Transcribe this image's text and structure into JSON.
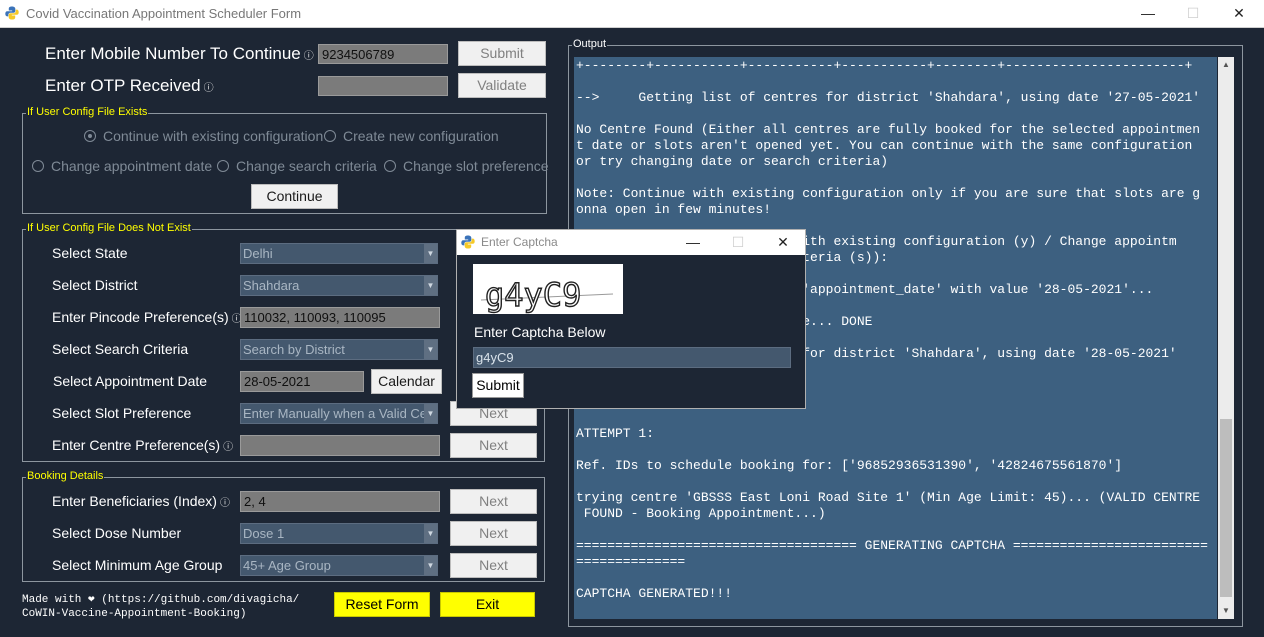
{
  "window": {
    "title": "Covid Vaccination Appointment Scheduler Form",
    "minimize": "—",
    "maximize": "☐",
    "close": "✕"
  },
  "mobile": {
    "label": "Enter Mobile Number To Continue",
    "info": "ⓘ",
    "value": "9234506789",
    "submit": "Submit"
  },
  "otp": {
    "label": "Enter OTP Received",
    "info": "ⓘ",
    "value": "",
    "validate": "Validate"
  },
  "config_exists": {
    "legend": "If User Config File Exists",
    "options": [
      "Continue with existing configuration",
      "Create new configuration",
      "Change appointment date",
      "Change search criteria",
      "Change slot preference"
    ],
    "selected_index": 0,
    "continue": "Continue"
  },
  "config_new": {
    "legend": "If User Config File Does Not Exist",
    "state": {
      "label": "Select State",
      "value": "Delhi"
    },
    "district": {
      "label": "Select District",
      "value": "Shahdara"
    },
    "pincode": {
      "label": "Enter Pincode Preference(s)",
      "info": "ⓘ",
      "value": "110032, 110093, 110095"
    },
    "search": {
      "label": "Select Search Criteria",
      "value": "Search by District"
    },
    "date": {
      "label": "Select Appointment Date",
      "value": "28-05-2021",
      "calendar": "Calendar"
    },
    "slot": {
      "label": "Select Slot Preference",
      "value": "Enter Manually when a Valid Ce",
      "next": "Next"
    },
    "centre": {
      "label": "Enter Centre Preference(s)",
      "info": "ⓘ",
      "value": "",
      "next": "Next"
    }
  },
  "booking": {
    "legend": "Booking Details",
    "beneficiaries": {
      "label": "Enter Beneficiaries (Index)",
      "info": "ⓘ",
      "value": "2, 4",
      "next": "Next"
    },
    "dose": {
      "label": "Select Dose Number",
      "value": "Dose 1",
      "next": "Next"
    },
    "age": {
      "label": "Select Minimum Age Group",
      "value": "45+ Age Group",
      "next": "Next"
    }
  },
  "footer": {
    "made_with_line1": "Made with ❤ (https://github.com/divagicha/",
    "made_with_line2": "CoWIN-Vaccine-Appointment-Booking)",
    "reset": "Reset Form",
    "exit": "Exit"
  },
  "output": {
    "legend": "Output",
    "lines": [
      "+--------+-----------+-----------+-----------+--------+-----------------------+",
      "",
      "-->     Getting list of centres for district 'Shahdara', using date '27-05-2021'",
      "",
      "No Centre Found (Either all centres are fully booked for the selected appointmen",
      "t date or slots aren't opened yet. You can continue with the same configuration",
      "or try changing date or search criteria)",
      "",
      "Note: Continue with existing configuration only if you are sure that slots are g",
      "onna open in few minutes!",
      "",
      "                          e with existing configuration (y) / Change appointm",
      "                          criteria (s)):",
      "",
      "                          le 'appointment_date' with value '28-05-2021'...",
      "",
      "                          file... DONE",
      "",
      "                          es for district 'Shahdara', using date '28-05-2021'",
      "",
      "",
      "",
      "",
      "ATTEMPT 1:",
      "",
      "Ref. IDs to schedule booking for: ['96852936531390', '42824675561870']",
      "",
      "trying centre 'GBSSS East Loni Road Site 1' (Min Age Limit: 45)... (VALID CENTRE",
      " FOUND - Booking Appointment...)",
      "",
      "==================================== GENERATING CAPTCHA =========================",
      "==============",
      "",
      "CAPTCHA GENERATED!!!"
    ]
  },
  "captcha_dialog": {
    "title": "Enter Captcha",
    "captcha_image_text": "g4yC9",
    "prompt": "Enter Captcha Below",
    "value": "g4yC9",
    "submit": "Submit"
  }
}
